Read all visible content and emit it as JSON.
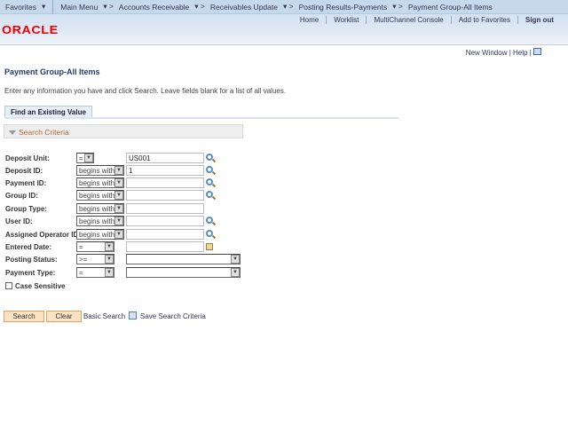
{
  "nav": {
    "favorites": "Favorites",
    "breadcrumb": [
      "Main Menu",
      "Accounts Receivable",
      "Receivables Update",
      "Posting Results-Payments",
      "Payment Group-All Items"
    ]
  },
  "header_links": [
    "Home",
    "Worklist",
    "MultiChannel Console",
    "Add to Favorites",
    "Sign out"
  ],
  "logo": "ORACLE",
  "new_window": "New Window",
  "help": "Help",
  "page_title": "Payment Group-All Items",
  "instructions": "Enter any information you have and click Search. Leave fields blank for a list of all values.",
  "tab": "Find an Existing Value",
  "section": "Search Criteria",
  "fields": [
    {
      "label": "Deposit Unit:",
      "op": "=",
      "value": "US001",
      "icon": "lookup"
    },
    {
      "label": "Deposit ID:",
      "op": "begins with",
      "value": "1",
      "icon": "lookup"
    },
    {
      "label": "Payment ID:",
      "op": "begins with",
      "value": "",
      "icon": "lookup"
    },
    {
      "label": "Group ID:",
      "op": "begins with",
      "value": "",
      "icon": "lookup"
    },
    {
      "label": "Group Type:",
      "op": "begins with",
      "value": "",
      "icon": ""
    },
    {
      "label": "User ID:",
      "op": "begins with",
      "value": "",
      "icon": "lookup"
    },
    {
      "label": "Assigned Operator ID:",
      "op": "begins with",
      "value": "",
      "icon": "lookup"
    },
    {
      "label": "Entered Date:",
      "op": "=",
      "value": "",
      "icon": "calendar"
    },
    {
      "label": "Posting Status:",
      "op": ">=",
      "value": "",
      "icon": ""
    },
    {
      "label": "Payment Type:",
      "op": "=",
      "value": "",
      "icon": ""
    }
  ],
  "case_sensitive": "Case Sensitive",
  "buttons": {
    "search": "Search",
    "clear": "Clear",
    "basic_search": "Basic Search",
    "save_criteria": "Save Search Criteria"
  }
}
